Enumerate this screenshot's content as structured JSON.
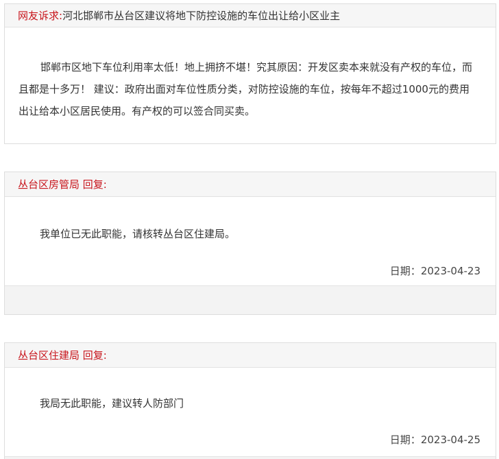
{
  "complaint": {
    "label": "网友诉求:",
    "title": "河北邯郸市丛台区建议将地下防控设施的车位出让给小区业主",
    "body": "邯郸市区地下车位利用率太低！地上拥挤不堪！究其原因：开发区卖本来就没有产权的车位，而且都是十多万！ 建议：政府出面对车位性质分类，对防控设施的车位，按每年不超过1000元的费用出让给本小区居民使用。有产权的可以签合同买卖。"
  },
  "replies": [
    {
      "org": "丛台区房管局",
      "reply_label": "回复:",
      "body": "我单位已无此职能，请核转丛台区住建局。",
      "date_label": "日期：",
      "date": "2023-04-23"
    },
    {
      "org": "丛台区住建局",
      "reply_label": "回复:",
      "body": "我局无此职能，建议转人防部门",
      "date_label": "日期：",
      "date": "2023-04-25"
    }
  ]
}
